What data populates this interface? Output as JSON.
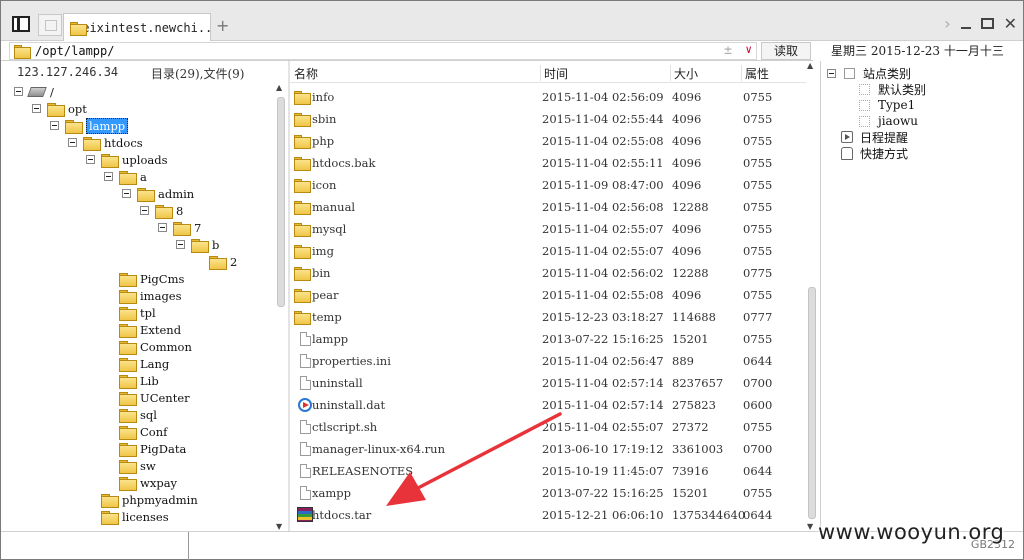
{
  "titlebar": {
    "tab_title": "weixintest.newchi...",
    "new_tab_symbol": "+",
    "icons": [
      "sidebar-toggle-icon",
      "blank-tab-icon",
      "folder-icon",
      "chevron-right-icon",
      "minimize-icon",
      "maximize-icon",
      "close-icon"
    ]
  },
  "address": {
    "path": "/opt/lampp/",
    "add_symbol": "±",
    "dropdown_symbol": "∨",
    "read_button": "读取"
  },
  "date": {
    "weekday": "星期三",
    "date": "2015-12-23",
    "lunar": "十一月十三"
  },
  "left": {
    "host_ip": "123.127.246.34",
    "counts": "目录(29),文件(9)",
    "tree": [
      {
        "label": "/",
        "icon": "drive-icon",
        "depth": 0,
        "expander": true
      },
      {
        "label": "opt",
        "icon": "folder-icon",
        "depth": 1,
        "expander": true
      },
      {
        "label": "lampp",
        "icon": "folder-icon",
        "depth": 2,
        "expander": true,
        "selected": true
      },
      {
        "label": "htdocs",
        "icon": "folder-icon",
        "depth": 3,
        "expander": true
      },
      {
        "label": "uploads",
        "icon": "folder-icon",
        "depth": 4,
        "expander": true
      },
      {
        "label": "a",
        "icon": "folder-icon",
        "depth": 5,
        "expander": true
      },
      {
        "label": "admin",
        "icon": "folder-icon",
        "depth": 6,
        "expander": true
      },
      {
        "label": "8",
        "icon": "folder-icon",
        "depth": 7,
        "expander": true
      },
      {
        "label": "7",
        "icon": "folder-icon",
        "depth": 8,
        "expander": true
      },
      {
        "label": "b",
        "icon": "folder-icon",
        "depth": 9,
        "expander": true
      },
      {
        "label": "2",
        "icon": "folder-icon",
        "depth": 10,
        "expander": false
      },
      {
        "label": "PigCms",
        "icon": "folder-icon",
        "depth": 5,
        "expander": false
      },
      {
        "label": "images",
        "icon": "folder-icon",
        "depth": 5,
        "expander": false
      },
      {
        "label": "tpl",
        "icon": "folder-icon",
        "depth": 5,
        "expander": false
      },
      {
        "label": "Extend",
        "icon": "folder-icon",
        "depth": 5,
        "expander": false
      },
      {
        "label": "Common",
        "icon": "folder-icon",
        "depth": 5,
        "expander": false
      },
      {
        "label": "Lang",
        "icon": "folder-icon",
        "depth": 5,
        "expander": false
      },
      {
        "label": "Lib",
        "icon": "folder-icon",
        "depth": 5,
        "expander": false
      },
      {
        "label": "UCenter",
        "icon": "folder-icon",
        "depth": 5,
        "expander": false
      },
      {
        "label": "sql",
        "icon": "folder-icon",
        "depth": 5,
        "expander": false
      },
      {
        "label": "Conf",
        "icon": "folder-icon",
        "depth": 5,
        "expander": false
      },
      {
        "label": "PigData",
        "icon": "folder-icon",
        "depth": 5,
        "expander": false
      },
      {
        "label": "sw",
        "icon": "folder-icon",
        "depth": 5,
        "expander": false
      },
      {
        "label": "wxpay",
        "icon": "folder-icon",
        "depth": 5,
        "expander": false
      },
      {
        "label": "phpmyadmin",
        "icon": "folder-icon",
        "depth": 4,
        "expander": false
      },
      {
        "label": "licenses",
        "icon": "folder-icon",
        "depth": 4,
        "expander": false
      }
    ]
  },
  "files": {
    "columns": {
      "name": "名称",
      "time": "时间",
      "size": "大小",
      "perm": "属性"
    },
    "rows": [
      {
        "name": "info",
        "time": "2015-11-04 02:56:09",
        "size": "4096",
        "perm": "0755",
        "icon": "folder-icon"
      },
      {
        "name": "sbin",
        "time": "2015-11-04 02:55:44",
        "size": "4096",
        "perm": "0755",
        "icon": "folder-icon"
      },
      {
        "name": "php",
        "time": "2015-11-04 02:55:08",
        "size": "4096",
        "perm": "0755",
        "icon": "folder-icon"
      },
      {
        "name": "htdocs.bak",
        "time": "2015-11-04 02:55:11",
        "size": "4096",
        "perm": "0755",
        "icon": "folder-icon"
      },
      {
        "name": "icon",
        "time": "2015-11-09 08:47:00",
        "size": "4096",
        "perm": "0755",
        "icon": "folder-icon"
      },
      {
        "name": "manual",
        "time": "2015-11-04 02:56:08",
        "size": "12288",
        "perm": "0755",
        "icon": "folder-icon"
      },
      {
        "name": "mysql",
        "time": "2015-11-04 02:55:07",
        "size": "4096",
        "perm": "0755",
        "icon": "folder-icon"
      },
      {
        "name": "img",
        "time": "2015-11-04 02:55:07",
        "size": "4096",
        "perm": "0755",
        "icon": "folder-icon"
      },
      {
        "name": "bin",
        "time": "2015-11-04 02:56:02",
        "size": "12288",
        "perm": "0775",
        "icon": "folder-icon"
      },
      {
        "name": "pear",
        "time": "2015-11-04 02:55:08",
        "size": "4096",
        "perm": "0755",
        "icon": "folder-icon"
      },
      {
        "name": "temp",
        "time": "2015-12-23 03:18:27",
        "size": "114688",
        "perm": "0777",
        "icon": "folder-icon"
      },
      {
        "name": "lampp",
        "time": "2013-07-22 15:16:25",
        "size": "15201",
        "perm": "0755",
        "icon": "file-icon"
      },
      {
        "name": "properties.ini",
        "time": "2015-11-04 02:56:47",
        "size": "889",
        "perm": "0644",
        "icon": "file-icon"
      },
      {
        "name": "uninstall",
        "time": "2015-11-04 02:57:14",
        "size": "8237657",
        "perm": "0700",
        "icon": "file-icon"
      },
      {
        "name": "uninstall.dat",
        "time": "2015-11-04 02:57:14",
        "size": "275823",
        "perm": "0600",
        "icon": "media-file-icon"
      },
      {
        "name": "ctlscript.sh",
        "time": "2015-11-04 02:55:07",
        "size": "27372",
        "perm": "0755",
        "icon": "file-icon"
      },
      {
        "name": "manager-linux-x64.run",
        "time": "2013-06-10 17:19:12",
        "size": "3361003",
        "perm": "0700",
        "icon": "file-icon"
      },
      {
        "name": "RELEASENOTES",
        "time": "2015-10-19 11:45:07",
        "size": "73916",
        "perm": "0644",
        "icon": "file-icon"
      },
      {
        "name": "xampp",
        "time": "2013-07-22 15:16:25",
        "size": "15201",
        "perm": "0755",
        "icon": "file-icon"
      },
      {
        "name": "htdocs.tar",
        "time": "2015-12-21 06:06:10",
        "size": "1375344640",
        "perm": "0644",
        "icon": "archive-icon"
      }
    ]
  },
  "right": {
    "items": [
      {
        "label": "站点类别",
        "kind": "group"
      },
      {
        "label": "默认类别",
        "kind": "child"
      },
      {
        "label": "Type1",
        "kind": "child"
      },
      {
        "label": "jiaowu",
        "kind": "child"
      },
      {
        "label": "日程提醒",
        "kind": "calendar"
      },
      {
        "label": "快捷方式",
        "kind": "shortcut"
      }
    ]
  },
  "status": {
    "encoding": "GB2312"
  },
  "watermark": "www.wooyun.org",
  "colors": {
    "selection": "#3399ff",
    "arrow": "#e8333a",
    "folder": "#efc546"
  }
}
